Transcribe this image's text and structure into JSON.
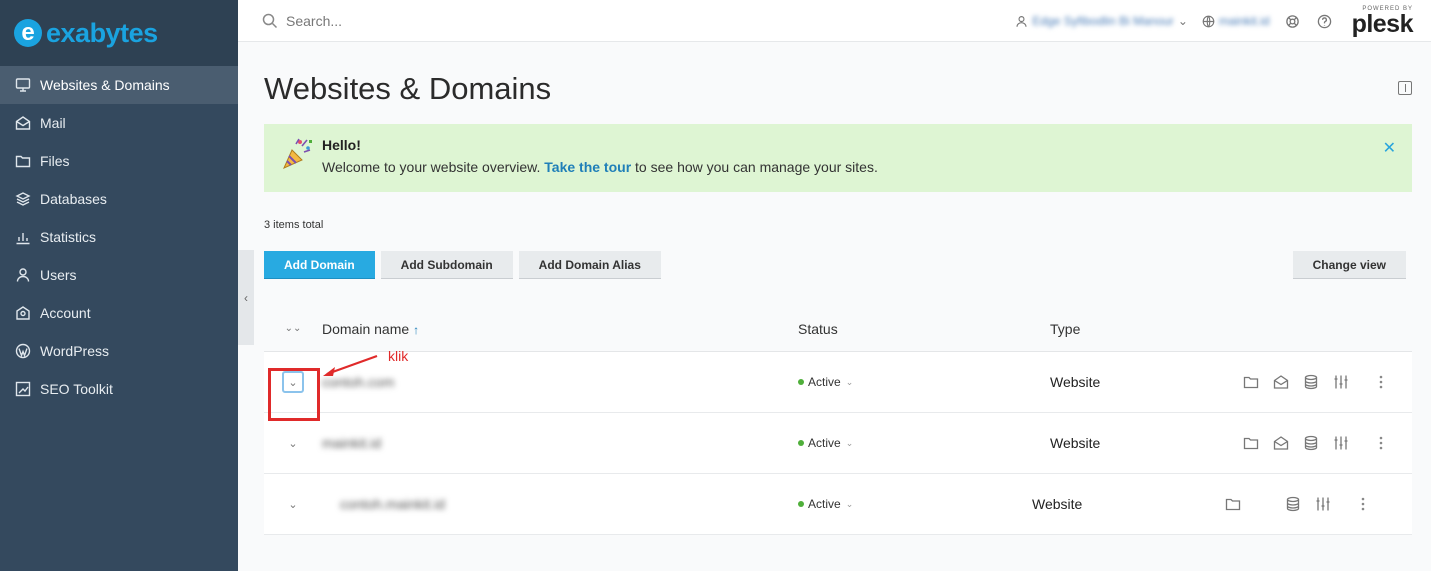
{
  "brand": {
    "logo_text_a": "exa",
    "logo_text_b": "bytes",
    "logo_letter": "e"
  },
  "sidebar": {
    "items": [
      {
        "label": "Websites & Domains",
        "icon": "monitor-icon",
        "active": true
      },
      {
        "label": "Mail",
        "icon": "mail-icon"
      },
      {
        "label": "Files",
        "icon": "folder-icon"
      },
      {
        "label": "Databases",
        "icon": "database-icon"
      },
      {
        "label": "Statistics",
        "icon": "bar-chart-icon"
      },
      {
        "label": "Users",
        "icon": "user-icon"
      },
      {
        "label": "Account",
        "icon": "account-icon"
      },
      {
        "label": "WordPress",
        "icon": "wordpress-icon"
      },
      {
        "label": "SEO Toolkit",
        "icon": "seo-icon"
      }
    ]
  },
  "topbar": {
    "search_placeholder": "Search...",
    "user_label": "Edge Syfibodlin Bi Manour",
    "domain_label": "mainkit.id",
    "powered_by": "POWERED BY",
    "product": "plesk"
  },
  "page": {
    "title": "Websites & Domains",
    "hello_title": "Hello!",
    "hello_text_before": "Welcome to your website overview. ",
    "hello_link": "Take the tour",
    "hello_text_after": " to see how you can manage your sites.",
    "items_total": "3 items total",
    "buttons": {
      "add_domain": "Add Domain",
      "add_subdomain": "Add Subdomain",
      "add_alias": "Add Domain Alias",
      "change_view": "Change view"
    }
  },
  "table": {
    "headers": {
      "name": "Domain name",
      "status": "Status",
      "type": "Type"
    },
    "rows": [
      {
        "name": "contoh.com",
        "status": "Active",
        "type": "Website"
      },
      {
        "name": "mainkit.id",
        "status": "Active",
        "type": "Website"
      },
      {
        "name": "contoh.mainkit.id",
        "status": "Active",
        "type": "Website"
      }
    ]
  },
  "annotation": {
    "text": "klik",
    "color": "#e02a2a"
  },
  "colors": {
    "sidebar": "#34495e",
    "accent": "#28aae1",
    "banner": "#def5d3",
    "active": "#4faf3a"
  }
}
